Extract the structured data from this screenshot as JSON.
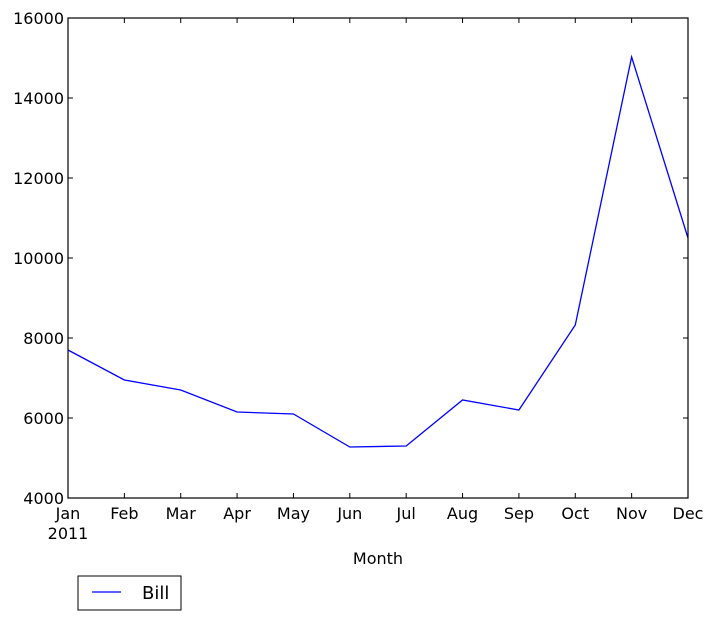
{
  "chart_data": {
    "type": "line",
    "title": "",
    "xlabel": "Month",
    "ylabel": "",
    "categories": [
      "Jan",
      "Feb",
      "Mar",
      "Apr",
      "May",
      "Jun",
      "Jul",
      "Aug",
      "Sep",
      "Oct",
      "Nov",
      "Dec"
    ],
    "x_sublabel": "2011",
    "ylim": [
      4000,
      16000
    ],
    "yticks": [
      4000,
      6000,
      8000,
      10000,
      12000,
      14000,
      16000
    ],
    "ytick_labels": [
      "4000",
      "6000",
      "8000",
      "10000",
      "12000",
      "14000",
      "16000"
    ],
    "grid": false,
    "legend_position": "bottom-left, below axes",
    "series": [
      {
        "name": "Bill",
        "color": "#0000ff",
        "values": [
          7700,
          6950,
          6700,
          6150,
          6100,
          5275,
          5300,
          6450,
          6200,
          8325,
          15025,
          10500
        ]
      }
    ]
  }
}
